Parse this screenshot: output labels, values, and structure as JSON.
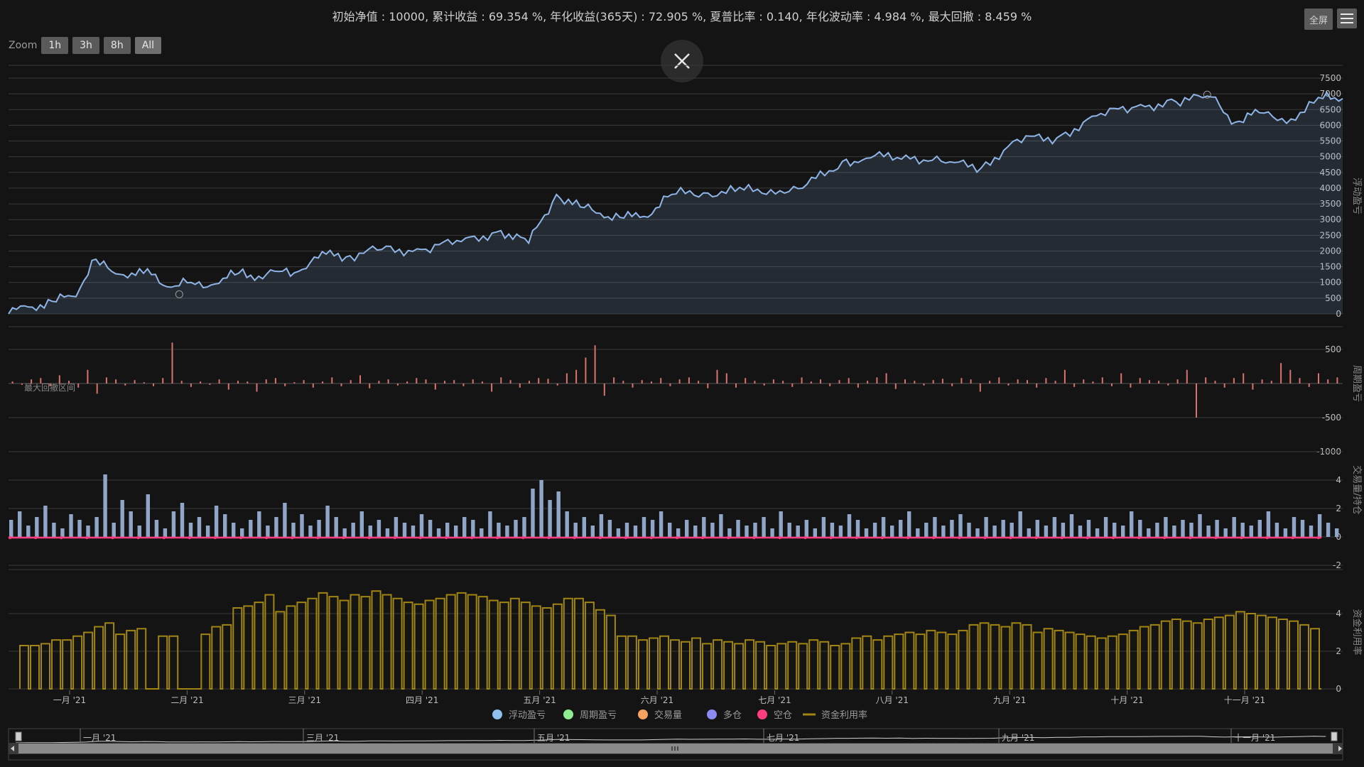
{
  "header": {
    "summary": "初始净值 : 10000, 累计收益 : 69.354 %, 年化收益(365天) : 72.905 %, 夏普比率 : 0.140, 年化波动率 : 4.984 %, 最大回撤 : 8.459 %"
  },
  "toolbar": {
    "zoom_label": "Zoom",
    "zoom_buttons": [
      "1h",
      "3h",
      "8h",
      "All"
    ],
    "fullscreen_label": "全屏"
  },
  "colors": {
    "background": "#141414",
    "equity_line": "#8fb5e8",
    "period_bar": "#d9736f",
    "volume_bar": "#8fa6c8",
    "short_line": "#ff3d7f",
    "utilization": "#a08512",
    "grid": "#3a3a3a",
    "text": "#cfcfcf"
  },
  "chart_data": [
    {
      "type": "area",
      "title": "",
      "ylabel": "浮动盈亏",
      "ylim": [
        0,
        7500
      ],
      "yticks": [
        0,
        500,
        1000,
        1500,
        2000,
        2500,
        3000,
        3500,
        4000,
        4500,
        5000,
        5500,
        6000,
        6500,
        7000,
        7500
      ],
      "series": [
        {
          "name": "浮动盈亏",
          "x": [
            "2021-01-01",
            "2021-01-06",
            "2021-01-12",
            "2021-01-18",
            "2021-01-22",
            "2021-01-27",
            "2021-02-01",
            "2021-02-06",
            "2021-02-11",
            "2021-02-16",
            "2021-02-22",
            "2021-02-28",
            "2021-03-05",
            "2021-03-10",
            "2021-03-15",
            "2021-03-22",
            "2021-03-28",
            "2021-04-05",
            "2021-04-15",
            "2021-04-25",
            "2021-05-05",
            "2021-05-12",
            "2021-05-19",
            "2021-05-25",
            "2021-05-30",
            "2021-06-05",
            "2021-06-10",
            "2021-06-17",
            "2021-06-25",
            "2021-07-03",
            "2021-07-12",
            "2021-07-20",
            "2021-07-30",
            "2021-08-05",
            "2021-08-15",
            "2021-08-25",
            "2021-09-03",
            "2021-09-12",
            "2021-09-22",
            "2021-10-02",
            "2021-10-12",
            "2021-10-22",
            "2021-10-31",
            "2021-11-06",
            "2021-11-12",
            "2021-11-20",
            "2021-11-28",
            "2021-12-03"
          ],
          "y": [
            0,
            220,
            400,
            550,
            1700,
            1350,
            1300,
            1250,
            850,
            1000,
            950,
            1300,
            1200,
            1350,
            1350,
            1900,
            1850,
            2050,
            2050,
            2300,
            2650,
            2250,
            3800,
            3400,
            3200,
            3050,
            3100,
            3800,
            3850,
            3900,
            3950,
            4000,
            4850,
            4950,
            5050,
            4800,
            4650,
            5550,
            5600,
            6300,
            6600,
            6750,
            6900,
            6100,
            6400,
            6200,
            6850,
            6850
          ]
        }
      ],
      "annotations": [
        "①",
        "①"
      ]
    },
    {
      "type": "bar",
      "ylabel": "周期盈亏",
      "ylim": [
        -1000,
        500
      ],
      "yticks": [
        -1000,
        -500,
        500
      ],
      "annotation": "最大回撤区间",
      "series": [
        {
          "name": "周期盈亏",
          "values": [
            30,
            -20,
            60,
            80,
            -40,
            120,
            40,
            -60,
            200,
            -150,
            90,
            60,
            -30,
            50,
            20,
            -40,
            80,
            600,
            40,
            -50,
            30,
            -20,
            60,
            -90,
            40,
            30,
            -120,
            60,
            80,
            -40,
            20,
            50,
            -60,
            30,
            90,
            -40,
            50,
            120,
            -70,
            40,
            60,
            -30,
            30,
            80,
            60,
            -90,
            40,
            50,
            -40,
            60,
            30,
            -120,
            90,
            50,
            -60,
            40,
            80,
            70,
            -30,
            150,
            200,
            380,
            560,
            -180,
            90,
            40,
            -60,
            50,
            30,
            80,
            -40,
            60,
            90,
            40,
            -70,
            200,
            150,
            -60,
            80,
            40,
            -30,
            60,
            40,
            -50,
            90,
            30,
            60,
            -40,
            50,
            80,
            -60,
            40,
            90,
            150,
            -80,
            60,
            40,
            -30,
            50,
            70,
            -40,
            80,
            60,
            -120,
            40,
            90,
            -30,
            60,
            50,
            -60,
            80,
            40,
            200,
            -50,
            60,
            30,
            90,
            -40,
            150,
            -60,
            80,
            50,
            40,
            -30,
            60,
            200,
            -500,
            90,
            40,
            -60,
            80,
            150,
            -90,
            60,
            40,
            300,
            200,
            80,
            -50,
            150,
            60,
            90
          ]
        }
      ]
    },
    {
      "type": "bar",
      "ylabel": "交易量/持仓",
      "ylim": [
        -2,
        4
      ],
      "yticks": [
        -2,
        0,
        2,
        4
      ],
      "series": [
        {
          "name": "交易量",
          "values": [
            1.2,
            1.8,
            0.8,
            1.4,
            2.2,
            1.0,
            0.6,
            1.6,
            1.2,
            0.8,
            1.4,
            4.4,
            1.0,
            2.6,
            1.8,
            0.8,
            3.0,
            1.2,
            0.6,
            1.8,
            2.4,
            1.0,
            1.4,
            0.8,
            2.2,
            1.6,
            1.0,
            0.6,
            1.2,
            1.8,
            0.8,
            1.4,
            2.4,
            1.0,
            1.6,
            0.8,
            1.2,
            2.2,
            1.4,
            0.6,
            1.0,
            1.8,
            0.8,
            1.2,
            0.6,
            1.4,
            1.0,
            0.8,
            1.6,
            1.2,
            0.6,
            1.0,
            0.8,
            1.4,
            1.2,
            0.6,
            1.8,
            1.0,
            0.8,
            1.2,
            1.4,
            3.4,
            4.0,
            2.6,
            3.2,
            1.8,
            1.0,
            1.4,
            0.8,
            1.6,
            1.2,
            0.6,
            1.0,
            0.8,
            1.4,
            1.2,
            1.8,
            1.0,
            0.6,
            1.2,
            0.8,
            1.4,
            1.0,
            1.6,
            0.6,
            1.2,
            0.8,
            1.0,
            1.4,
            0.6,
            1.8,
            1.0,
            0.8,
            1.2,
            0.6,
            1.4,
            1.0,
            0.8,
            1.6,
            1.2,
            0.6,
            1.0,
            1.4,
            0.8,
            1.2,
            1.8,
            0.6,
            1.0,
            1.4,
            0.8,
            1.2,
            1.6,
            1.0,
            0.6,
            1.4,
            0.8,
            1.2,
            1.0,
            1.8,
            0.6,
            1.2,
            0.8,
            1.4,
            1.0,
            1.6,
            0.8,
            1.2,
            0.6,
            1.4,
            1.0,
            0.8,
            1.8,
            1.2,
            0.6,
            1.0,
            1.4,
            0.8,
            1.2,
            1.0,
            1.6,
            0.8,
            1.2,
            0.6,
            1.4,
            1.0,
            0.8,
            1.2,
            1.8,
            1.0,
            0.6,
            1.4,
            1.2,
            0.8,
            1.6,
            1.0,
            0.6
          ]
        },
        {
          "name": "空仓",
          "values": [
            0
          ]
        }
      ]
    },
    {
      "type": "bar",
      "ylabel": "资金利用率",
      "ylim": [
        0,
        4.5
      ],
      "yticks": [
        0,
        2,
        4
      ],
      "series": [
        {
          "name": "资金利用率",
          "values": [
            2.3,
            2.3,
            2.4,
            2.6,
            2.6,
            2.8,
            3.0,
            3.3,
            3.5,
            2.9,
            3.1,
            3.2,
            0,
            2.8,
            2.8,
            0,
            0,
            2.9,
            3.3,
            3.4,
            4.3,
            4.4,
            4.6,
            5.0,
            4.1,
            4.4,
            4.6,
            4.8,
            5.1,
            4.9,
            4.7,
            5.0,
            4.9,
            5.2,
            5.0,
            4.8,
            4.6,
            4.5,
            4.7,
            4.8,
            5.0,
            5.1,
            5.0,
            4.9,
            4.7,
            4.6,
            4.8,
            4.6,
            4.4,
            4.3,
            4.5,
            4.8,
            4.8,
            4.6,
            4.2,
            3.9,
            2.8,
            2.8,
            2.6,
            2.7,
            2.8,
            2.6,
            2.5,
            2.7,
            2.4,
            2.6,
            2.5,
            2.4,
            2.6,
            2.5,
            2.3,
            2.4,
            2.5,
            2.4,
            2.6,
            2.5,
            2.3,
            2.4,
            2.7,
            2.8,
            2.6,
            2.8,
            2.9,
            3.0,
            2.9,
            3.1,
            3.0,
            2.9,
            3.1,
            3.4,
            3.5,
            3.4,
            3.3,
            3.5,
            3.4,
            3.0,
            3.2,
            3.1,
            3.0,
            2.9,
            2.8,
            2.7,
            2.8,
            2.9,
            3.1,
            3.3,
            3.4,
            3.6,
            3.7,
            3.6,
            3.5,
            3.7,
            3.8,
            3.9,
            4.1,
            4.0,
            3.9,
            3.8,
            3.7,
            3.6,
            3.4,
            3.2
          ]
        }
      ]
    },
    {
      "type": "line",
      "title": "",
      "xlabels": [
        "一月 '21",
        "三月 '21",
        "五月 '21",
        "七月 '21",
        "九月 '21",
        "十一月 '21"
      ]
    }
  ],
  "x_axis": {
    "labels": [
      "一月 '21",
      "二月 '21",
      "三月 '21",
      "四月 '21",
      "五月 '21",
      "六月 '21",
      "七月 '21",
      "八月 '21",
      "九月 '21",
      "十月 '21",
      "十一月 '21"
    ]
  },
  "legend": {
    "placement": "bottom-center",
    "items": [
      {
        "label": "浮动盈亏",
        "color": "#8fc1f0",
        "shape": "circle"
      },
      {
        "label": "周期盈亏",
        "color": "#90ee90",
        "shape": "circle"
      },
      {
        "label": "交易量",
        "color": "#f4a460",
        "shape": "circle"
      },
      {
        "label": "多仓",
        "color": "#8a8af0",
        "shape": "circle"
      },
      {
        "label": "空仓",
        "color": "#ff3d7f",
        "shape": "circle"
      },
      {
        "label": "资金利用率",
        "color": "#a08512",
        "shape": "line"
      }
    ]
  }
}
